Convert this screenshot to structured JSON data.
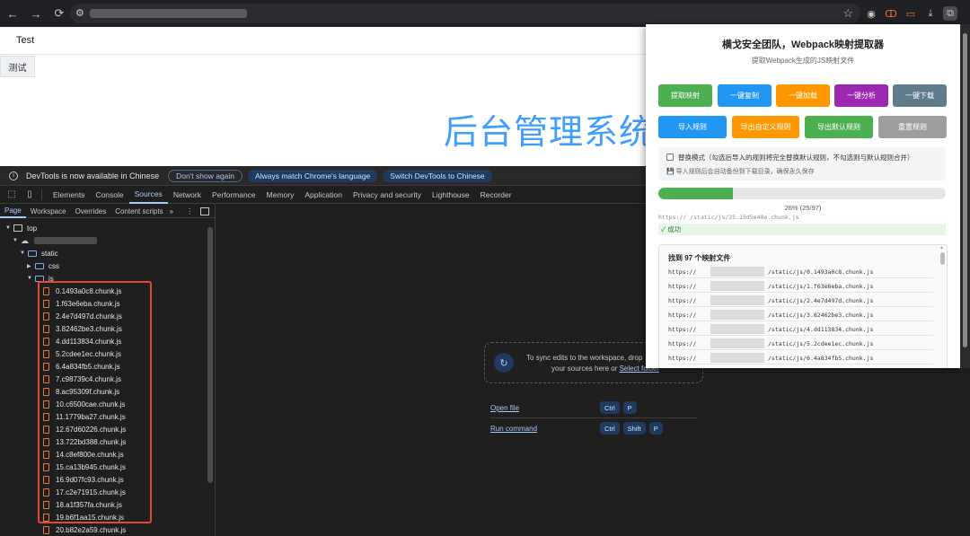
{
  "browser": {
    "back_icon": "←",
    "forward_icon": "→",
    "reload_icon": "⟳",
    "site_icon": "⚙",
    "star_icon": "☆",
    "extension_icons": [
      "◉",
      "ↀ",
      "▭",
      "⤓",
      "⧉"
    ]
  },
  "page": {
    "header": "Test",
    "tab_label": "测试",
    "big_title": "后台管理系统"
  },
  "infobar": {
    "icon": "i",
    "message": "DevTools is now available in Chinese",
    "btn_dont_show": "Don't show again",
    "btn_match_language": "Always match Chrome's language",
    "btn_switch": "Switch DevTools to Chinese"
  },
  "devtools": {
    "tabs": [
      "Elements",
      "Console",
      "Sources",
      "Network",
      "Performance",
      "Memory",
      "Application",
      "Privacy and security",
      "Lighthouse",
      "Recorder"
    ],
    "active_tab": "Sources",
    "sidebar_tabs": [
      "Page",
      "Workspace",
      "Overrides",
      "Content scripts"
    ],
    "sidebar_more": "»",
    "sidebar_kebab": "⋮",
    "tree": {
      "top_label": "top",
      "static_label": "static",
      "css_label": "css",
      "js_label": "js"
    },
    "files": [
      "0.1493a0c8.chunk.js",
      "1.f63e6eba.chunk.js",
      "2.4e7d497d.chunk.js",
      "3.82462be3.chunk.js",
      "4.dd113834.chunk.js",
      "5.2cdee1ec.chunk.js",
      "6.4a834fb5.chunk.js",
      "7.c98739c4.chunk.js",
      "8.ac95309f.chunk.js",
      "10.c6500cae.chunk.js",
      "11.1779ba27.chunk.js",
      "12.67d60226.chunk.js",
      "13.722bd388.chunk.js",
      "14.c8ef800e.chunk.js",
      "15.ca13b945.chunk.js",
      "16.9d07fc93.chunk.js",
      "17.c2e71915.chunk.js",
      "18.a1f357fa.chunk.js",
      "19.b6f1aa15.chunk.js",
      "20.b82e2a59.chunk.js"
    ],
    "workspace": {
      "sync_icon": "↻",
      "line1": "To sync edits to the workspace, drop",
      "line2_prefix": "your sources here or ",
      "select_link": "Select folder"
    },
    "shortcuts": [
      {
        "label": "Open file",
        "keys": [
          "Ctrl",
          "P"
        ]
      },
      {
        "label": "Run command",
        "keys": [
          "Ctrl",
          "Shift",
          "P"
        ]
      }
    ]
  },
  "popup": {
    "title": "横戈安全团队，Webpack映射提取器",
    "subtitle": "提取Webpack生成的JS映射文件",
    "buttons_row1": [
      {
        "label": "提取映射",
        "color": "#4caf50"
      },
      {
        "label": "一键复制",
        "color": "#2196f3"
      },
      {
        "label": "一键加载",
        "color": "#ff9800"
      },
      {
        "label": "一键分析",
        "color": "#9c27b0"
      },
      {
        "label": "一键下载",
        "color": "#607d8b"
      }
    ],
    "buttons_row2": [
      {
        "label": "导入规则",
        "color": "#2196f3"
      },
      {
        "label": "导出自定义规则",
        "color": "#ff9800"
      },
      {
        "label": "导出默认规则",
        "color": "#4caf50"
      },
      {
        "label": "重置规则",
        "color": "#9e9e9e"
      }
    ],
    "replace_mode_label": "替换模式（勾选后导入的规则将完全替换默认规则，不勾选则与默认规则合并）",
    "replace_mode_checked": false,
    "replace_note": "💾 导入规则后会自动备份到下载目录，确保永久保存",
    "progress_fraction": 0.26,
    "progress_text": "26% (25/97)",
    "current_file": "https://                /static/js/25.15d5e40e.chunk.js",
    "status_text": "✓ 成功",
    "results_header": "找到 97 个映射文件",
    "result_prefix": "https://",
    "results": [
      "/static/js/0.1493a0c8.chunk.js",
      "/static/js/1.f63e6eba.chunk.js",
      "/static/js/2.4e7d497d.chunk.js",
      "/static/js/3.82462be3.chunk.js",
      "/static/js/4.dd113834.chunk.js",
      "/static/js/5.2cdee1ec.chunk.js",
      "/static/js/6.4a834fb5.chunk.js"
    ]
  }
}
